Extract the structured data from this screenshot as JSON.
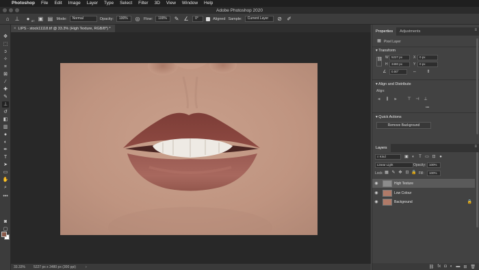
{
  "menubar": {
    "app": "Photoshop",
    "items": [
      "File",
      "Edit",
      "Image",
      "Layer",
      "Type",
      "Select",
      "Filter",
      "3D",
      "View",
      "Window",
      "Help"
    ]
  },
  "window_title": "Adobe Photoshop 2020",
  "options": {
    "brush_size": "87",
    "mode_label": "Mode:",
    "mode_value": "Normal",
    "opacity_label": "Opacity:",
    "opacity_value": "100%",
    "flow_label": "Flow:",
    "flow_value": "100%",
    "angle_value": "0°",
    "aligned_label": "Aligned",
    "sample_label": "Sample:",
    "sample_value": "Current Layer"
  },
  "document_tab": {
    "name": "LIPS - stock11118.tif @ 33.3% (High Texture, RGB/8*) *",
    "close": "×"
  },
  "status": {
    "zoom": "33.33%",
    "doc_size": "5227 px x 3480 px (300 ppi)",
    "arrow": "›"
  },
  "properties": {
    "tab_properties": "Properties",
    "tab_adjustments": "Adjustments",
    "kind": "Pixel Layer",
    "transform_title": "Transform",
    "w_label": "W",
    "w_value": "5227 px",
    "h_label": "H",
    "h_value": "3480 px",
    "x_label": "X",
    "x_value": "0 px",
    "y_label": "Y",
    "y_value": "0 px",
    "angle_value": "0.00°",
    "align_title": "Align and Distribute",
    "align_label": "Align:",
    "more": "•••",
    "quick_title": "Quick Actions",
    "remove_bg": "Remove Background"
  },
  "layers": {
    "tab": "Layers",
    "filter_kind": "Kind",
    "blend_mode": "Linear Light",
    "opacity_label": "Opacity:",
    "opacity_value": "100%",
    "lock_label": "Lock:",
    "fill_label": "Fill:",
    "fill_value": "100%",
    "items": [
      {
        "name": "High Texture",
        "thumb_color": "#8c8c8c"
      },
      {
        "name": "Low Colour",
        "thumb_color": "#b07a68"
      },
      {
        "name": "Background",
        "thumb_color": "#b07a68"
      }
    ]
  },
  "colors": {
    "foreground": "#8a5a4a",
    "background": "#ffffff",
    "lip": "#8b4a44",
    "skin": "#c79d8a"
  }
}
